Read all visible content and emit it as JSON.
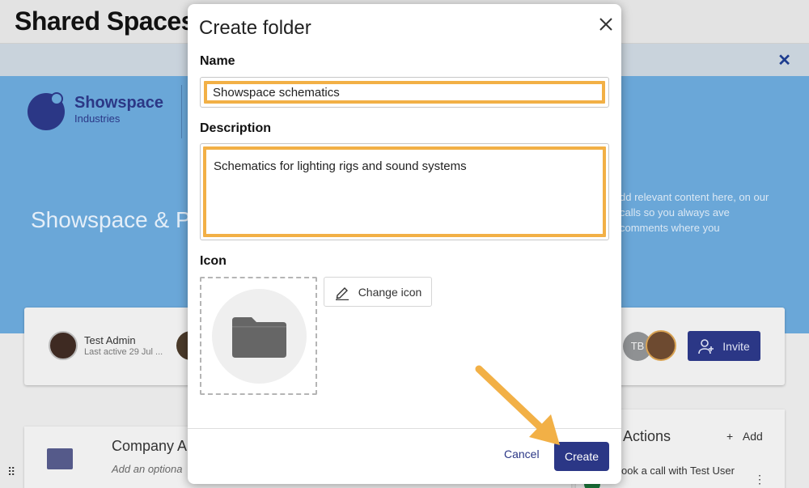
{
  "background": {
    "page_title": "Shared Spaces",
    "logo": {
      "name": "Showspace",
      "subtitle": "Industries"
    },
    "hero_heading": "Showspace & P",
    "hero_text": "dd relevant content here, on our calls so you always ave comments where you",
    "member": {
      "name": "Test Admin",
      "last_active": "Last active 29 Jul ..."
    },
    "member_initials": "TB",
    "invite_label": "Invite",
    "card": {
      "title": "Company A",
      "subtitle": "Add an optiona"
    },
    "actions": {
      "title": "Actions",
      "add_label": "Add",
      "item": "ook a call with Test User"
    }
  },
  "modal": {
    "title": "Create folder",
    "name_label": "Name",
    "name_value": "Showspace schematics",
    "description_label": "Description",
    "description_value": "Schematics for lighting rigs and sound systems",
    "icon_label": "Icon",
    "change_icon_label": "Change icon",
    "cancel_label": "Cancel",
    "create_label": "Create"
  },
  "colors": {
    "brand": "#2b3786",
    "highlight": "#f2b046",
    "hero": "#6aa7d8"
  }
}
